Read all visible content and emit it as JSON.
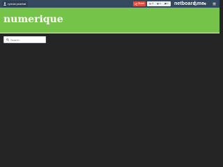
{
  "colors": {
    "topbar": "#34495e",
    "banner": "#76c34a",
    "share": "#e74c3c",
    "content_background": "#252525"
  },
  "topbar": {
    "user_label": "ryviola pnarbat",
    "user_icon": "person-icon",
    "share_label": "Share",
    "share_icon": "share-icon",
    "stats": [
      {
        "icon": "eye-icon",
        "value": "0"
      },
      {
        "icon": "heart-icon",
        "value": "0"
      },
      {
        "icon": "comment-icon",
        "value": "0"
      }
    ],
    "brand": "netboard.me",
    "right_icons": [
      "enter-icon",
      "volume-icon",
      "menu-icon"
    ]
  },
  "banner": {
    "title": "numerique"
  },
  "search": {
    "placeholder": "Search",
    "value": ""
  }
}
